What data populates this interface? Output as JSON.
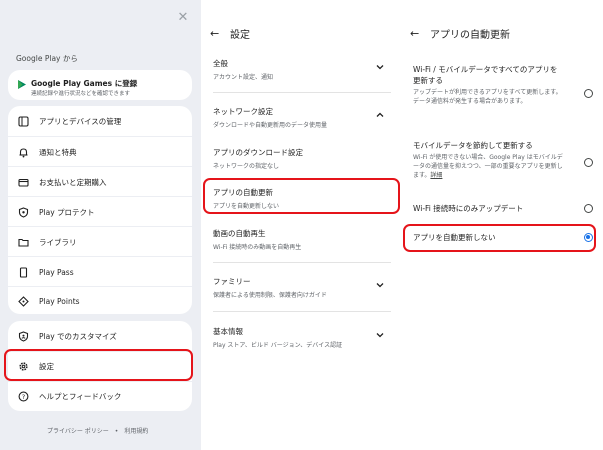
{
  "left_panel": {
    "from_text": "Google Play から",
    "games": {
      "title": "Google Play Games に登録",
      "subtitle": "連続記録や進行状況などを確認できます"
    },
    "group1": [
      {
        "label": "アプリとデバイスの管理",
        "icon": "apps-icon"
      },
      {
        "label": "通知と特典",
        "icon": "bell-icon"
      },
      {
        "label": "お支払いと定期購入",
        "icon": "card-icon"
      },
      {
        "label": "Play プロテクト",
        "icon": "shield-icon"
      },
      {
        "label": "ライブラリ",
        "icon": "folder-icon"
      },
      {
        "label": "Play Pass",
        "icon": "ticket-icon"
      },
      {
        "label": "Play Points",
        "icon": "diamond-icon"
      }
    ],
    "group2": [
      {
        "label": "Play でのカスタマイズ",
        "icon": "shield-person-icon"
      },
      {
        "label": "設定",
        "icon": "gear-icon"
      },
      {
        "label": "ヘルプとフィードバック",
        "icon": "help-icon"
      }
    ],
    "footer": {
      "privacy": "プライバシー ポリシー",
      "dot": "•",
      "terms": "利用規約"
    }
  },
  "middle_panel": {
    "title": "設定",
    "items": [
      {
        "title": "全般",
        "subtitle": "アカウント設定、通知",
        "chevron": "down"
      },
      {
        "title": "ネットワーク設定",
        "subtitle": "ダウンロードや自動更新用のデータ使用量",
        "chevron": "up"
      },
      {
        "title": "アプリのダウンロード設定",
        "subtitle": "ネットワークの指定なし"
      },
      {
        "title": "アプリの自動更新",
        "subtitle": "アプリを自動更新しない"
      },
      {
        "title": "動画の自動再生",
        "subtitle": "Wi-Fi 接続時のみ動画を自動再生"
      },
      {
        "title": "ファミリー",
        "subtitle": "保護者による使用制限、保護者向けガイド",
        "chevron": "down"
      },
      {
        "title": "基本情報",
        "subtitle": "Play ストア、ビルド バージョン、デバイス認証",
        "chevron": "down"
      }
    ]
  },
  "right_panel": {
    "title": "アプリの自動更新",
    "options": [
      {
        "title": "Wi-Fi / モバイルデータですべてのアプリを更新する",
        "desc": "アップデートが利用できるアプリをすべて更新します。データ通信料が発生する場合があります。",
        "selected": false
      },
      {
        "title": "モバイルデータを節約して更新する",
        "desc": "Wi-Fi が使用できない場合、Google Play はモバイルデータの通信量を抑えつつ、一部の重要なアプリを更新します。",
        "link": "詳細",
        "selected": false
      },
      {
        "title": "Wi-Fi 接続時にのみアップデート",
        "selected": false
      },
      {
        "title": "アプリを自動更新しない",
        "selected": true
      }
    ]
  },
  "colors": {
    "highlight": "#e5141a",
    "radio_selected": "#1a73e8",
    "left_bg": "#eceef3"
  }
}
